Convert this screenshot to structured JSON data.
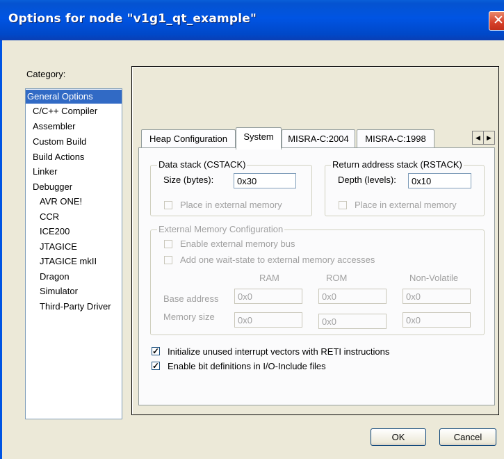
{
  "window": {
    "title": "Options for node \"v1g1_qt_example\"",
    "close_glyph": "✕"
  },
  "category": {
    "label": "Category:",
    "items": [
      {
        "label": "General Options",
        "selected": true
      },
      {
        "label": "C/C++ Compiler"
      },
      {
        "label": "Assembler"
      },
      {
        "label": "Custom Build"
      },
      {
        "label": "Build Actions"
      },
      {
        "label": "Linker"
      },
      {
        "label": "Debugger"
      },
      {
        "label": "AVR ONE!"
      },
      {
        "label": "CCR"
      },
      {
        "label": "ICE200"
      },
      {
        "label": "JTAGICE"
      },
      {
        "label": "JTAGICE mkII"
      },
      {
        "label": "Dragon"
      },
      {
        "label": "Simulator"
      },
      {
        "label": "Third-Party Driver"
      }
    ]
  },
  "tabs": [
    {
      "label": "Heap Configuration"
    },
    {
      "label": "System",
      "active": true
    },
    {
      "label": "MISRA-C:2004"
    },
    {
      "label": "MISRA-C:1998"
    }
  ],
  "tab_scroll": {
    "left": "◀",
    "right": "▶"
  },
  "data_stack": {
    "title": "Data stack (CSTACK)",
    "size_label": "Size (bytes):",
    "size_value": "0x30",
    "external_label": "Place in external memory"
  },
  "return_stack": {
    "title": "Return address stack (RSTACK)",
    "depth_label": "Depth (levels):",
    "depth_value": "0x10",
    "external_label": "Place in external memory"
  },
  "ext_mem": {
    "title": "External Memory Configuration",
    "enable_bus_label": "Enable external memory bus",
    "wait_state_label": "Add one wait-state to external memory accesses",
    "col_ram": "RAM",
    "col_rom": "ROM",
    "col_nv": "Non-Volatile",
    "base_label": "Base address",
    "size_label": "Memory size",
    "base": {
      "ram": "0x0",
      "rom": "0x0",
      "nv": "0x0"
    },
    "size": {
      "ram": "0x0",
      "rom": "0x0",
      "nv": "0x0"
    }
  },
  "options": {
    "init_vectors_label": "Initialize unused interrupt vectors with RETI instructions",
    "init_vectors_checked": true,
    "bit_defs_label": "Enable bit definitions in I/O-Include files",
    "bit_defs_checked": true,
    "check_glyph": "✓"
  },
  "buttons": {
    "ok": "OK",
    "cancel": "Cancel"
  }
}
